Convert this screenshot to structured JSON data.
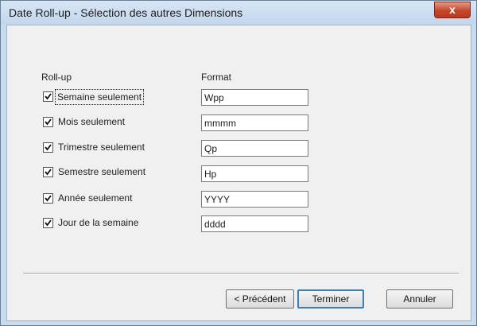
{
  "window": {
    "title": "Date Roll-up - Sélection des autres Dimensions",
    "close_label": "x"
  },
  "headers": {
    "rollup": "Roll-up",
    "format": "Format"
  },
  "rows": [
    {
      "label": "Semaine seulement",
      "checked": true,
      "format": "Wpp"
    },
    {
      "label": "Mois seulement",
      "checked": true,
      "format": "mmmm"
    },
    {
      "label": "Trimestre seulement",
      "checked": true,
      "format": "Qp"
    },
    {
      "label": "Semestre seulement",
      "checked": true,
      "format": "Hp"
    },
    {
      "label": "Année seulement",
      "checked": true,
      "format": "YYYY"
    },
    {
      "label": "Jour de la semaine",
      "checked": true,
      "format": "dddd"
    }
  ],
  "buttons": {
    "previous": "< Précédent",
    "finish": "Terminer",
    "cancel": "Annuler"
  }
}
